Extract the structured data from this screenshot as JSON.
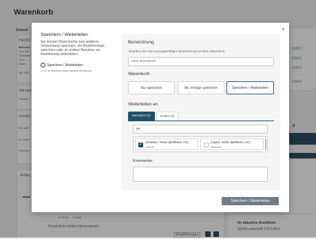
{
  "page": {
    "title": "Warenkorb",
    "bg_texts": {
      "schnell": "Schnell",
      "rechnung": "Rechn",
      "bellheim": "Bellheim",
      "lisa": "Lisa Löff",
      "schloss": "Schlossst",
      "kreis": "Kreis",
      "beard": "Bearb",
      "tel": "Tel: 0633",
      "versand": "Versan",
      "standard": "Standar",
      "zusatz": "Zusatz",
      "ihre": "Ihre aufT",
      "ihrzeichen": "Ihr Zeich",
      "komm": "Kommen",
      "artikel": "Artike",
      "date": "27.05.24",
      "pack": "4 Pack",
      "personal_info": "Persönliche Artikel-Informationen",
      "empfehlungen": "Empfehlungen",
      "price1": "3,02 €",
      "price2": "9,50 €",
      "price3": "3,02 €",
      "price4": "2,54 €",
      "credit_title": "Ihr aktuelles Kreditlimit",
      "credit_value": "SEPA Lastschrift 1.972,48 €",
      "side_b": "B"
    }
  },
  "modal": {
    "left_title": "Speichern / Weiterleiten",
    "left_description": "Sie können Warenkörbe zum späteren Verwendung speichern, als Bestellvorlage speichern oder an andere Benutzer zur Bearbeitung weiterleiten.",
    "step_icon": "i",
    "step_label": "Speichern / Weiterleiten",
    "step_sub": "z. B. im Rahmen eines Bestell-Workflows",
    "close_icon": "×",
    "bezeichnung_label": "Bezeichnung",
    "bezeichnung_hint": "Vergeben Sie eine aussagekräftigen Bezeichnung für Ihren Warenkorb",
    "bezeichnung_value": "Mein Warenkorb",
    "warenkorb_label": "Warenkorb",
    "options": [
      "Nur speichern",
      "Als Vorlage speichern",
      "Speichern / Weiterleiten"
    ],
    "weiterleiten_label": "Weiterleiten an",
    "tabs": [
      "Benutzer (1)",
      "Rollen (0)"
    ],
    "search_value": "pe",
    "users": [
      {
        "name": "Jenssen, Peter (Bellheim AG)",
        "role": "LAGER",
        "checked": true
      },
      {
        "name": "Lopez, Sofia (Bellheim AG)",
        "role": "EINKAUF",
        "checked": false
      }
    ],
    "check_icon": "✓",
    "kommentar_label": "Kommentar",
    "submit_label": "Speichern / Weiterleiten"
  }
}
